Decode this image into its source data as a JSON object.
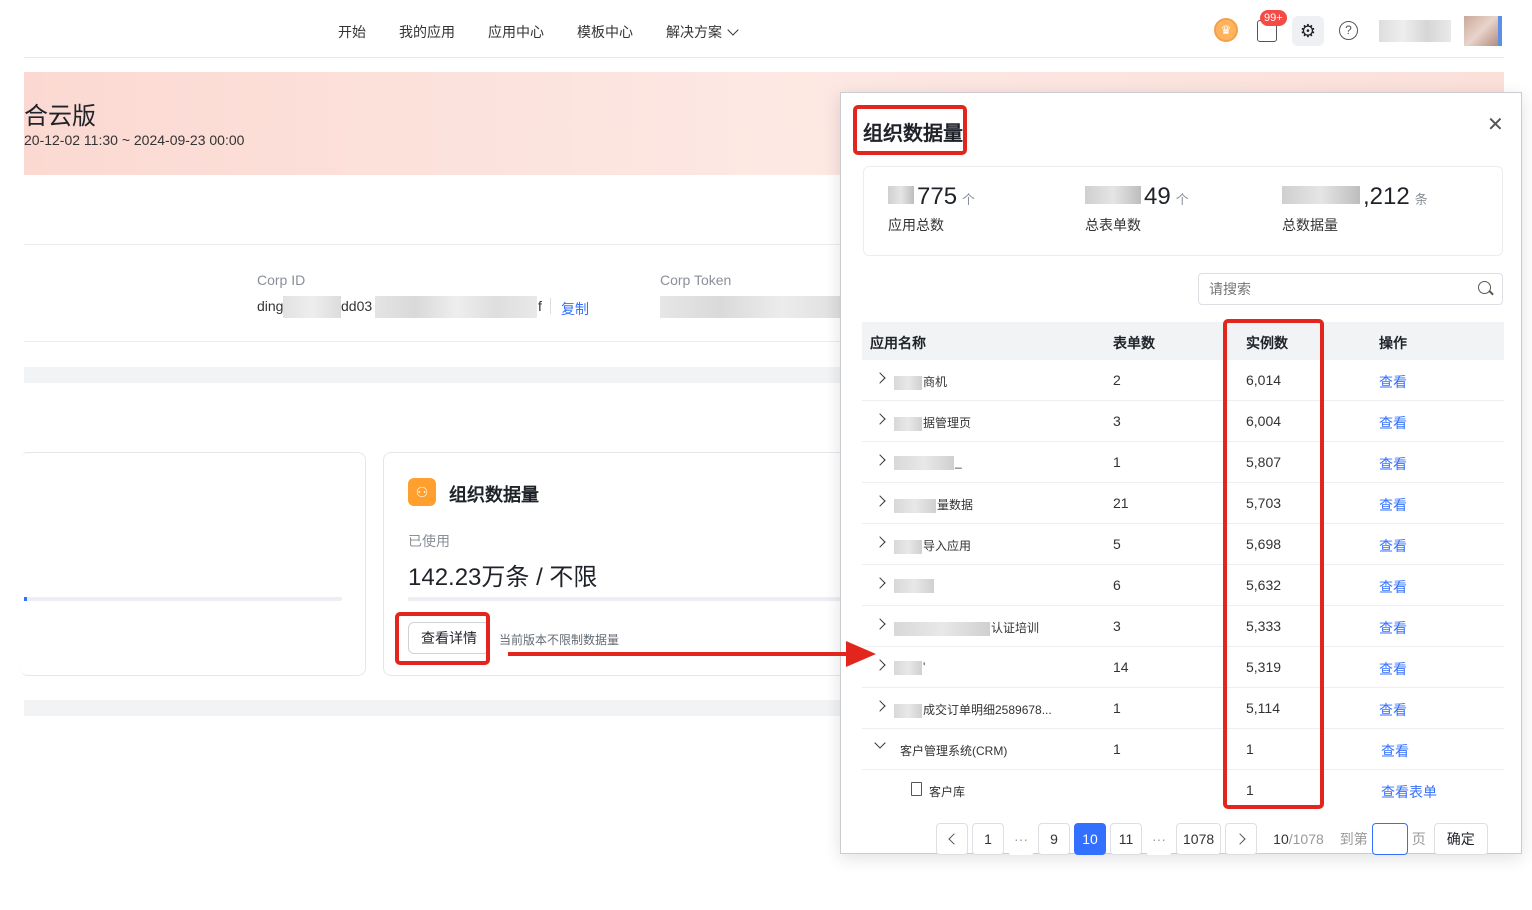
{
  "nav": {
    "links": [
      "开始",
      "我的应用",
      "应用中心",
      "模板中心",
      "解决方案"
    ],
    "badge": "99+"
  },
  "banner": {
    "title": "合云版",
    "date_range": "20-12-02 11:30 ~ 2024-09-23 00:00"
  },
  "corp": {
    "id_label": "Corp ID",
    "id_prefix": "ding",
    "id_mid": "dd03",
    "id_suffix": "f",
    "copy_label": "复制",
    "token_label": "Corp Token"
  },
  "org_card": {
    "title": "组织数据量",
    "used_label": "已使用",
    "used_value": "142.23万条 / 不限",
    "detail_button": "查看详情",
    "hint": "当前版本不限制数据量"
  },
  "modal": {
    "title": "组织数据量",
    "stats": [
      {
        "value": "775",
        "unit": "个",
        "label": "应用总数"
      },
      {
        "value": "49",
        "unit": "个",
        "label": "总表单数"
      },
      {
        "value": ",212",
        "unit": "条",
        "label": "总数据量"
      }
    ],
    "search_placeholder": "请搜索",
    "columns": [
      "应用名称",
      "表单数",
      "实例数",
      "操作"
    ],
    "rows": [
      {
        "name": "商机",
        "forms": "2",
        "instances": "6,014",
        "op": "查看"
      },
      {
        "name": "据管理页",
        "forms": "3",
        "instances": "6,004",
        "op": "查看"
      },
      {
        "name": "_",
        "forms": "1",
        "instances": "5,807",
        "op": "查看"
      },
      {
        "name": "量数据",
        "forms": "21",
        "instances": "5,703",
        "op": "查看"
      },
      {
        "name": "导入应用",
        "forms": "5",
        "instances": "5,698",
        "op": "查看"
      },
      {
        "name": "",
        "forms": "6",
        "instances": "5,632",
        "op": "查看"
      },
      {
        "name": "认证培训",
        "forms": "3",
        "instances": "5,333",
        "op": "查看"
      },
      {
        "name": "'",
        "forms": "14",
        "instances": "5,319",
        "op": "查看"
      },
      {
        "name": "成交订单明细2589678...",
        "forms": "1",
        "instances": "5,114",
        "op": "查看"
      },
      {
        "name": "客户管理系统(CRM)",
        "forms": "1",
        "instances": "1",
        "op": "查看"
      },
      {
        "name": "客户库",
        "forms": "",
        "instances": "1",
        "op": "查看表单"
      }
    ],
    "pager": {
      "pages": [
        "1",
        "9",
        "10",
        "11",
        "1078"
      ],
      "current": "10",
      "total": "/1078",
      "goto_label": "到第",
      "page_word": "页",
      "confirm": "确定"
    }
  }
}
